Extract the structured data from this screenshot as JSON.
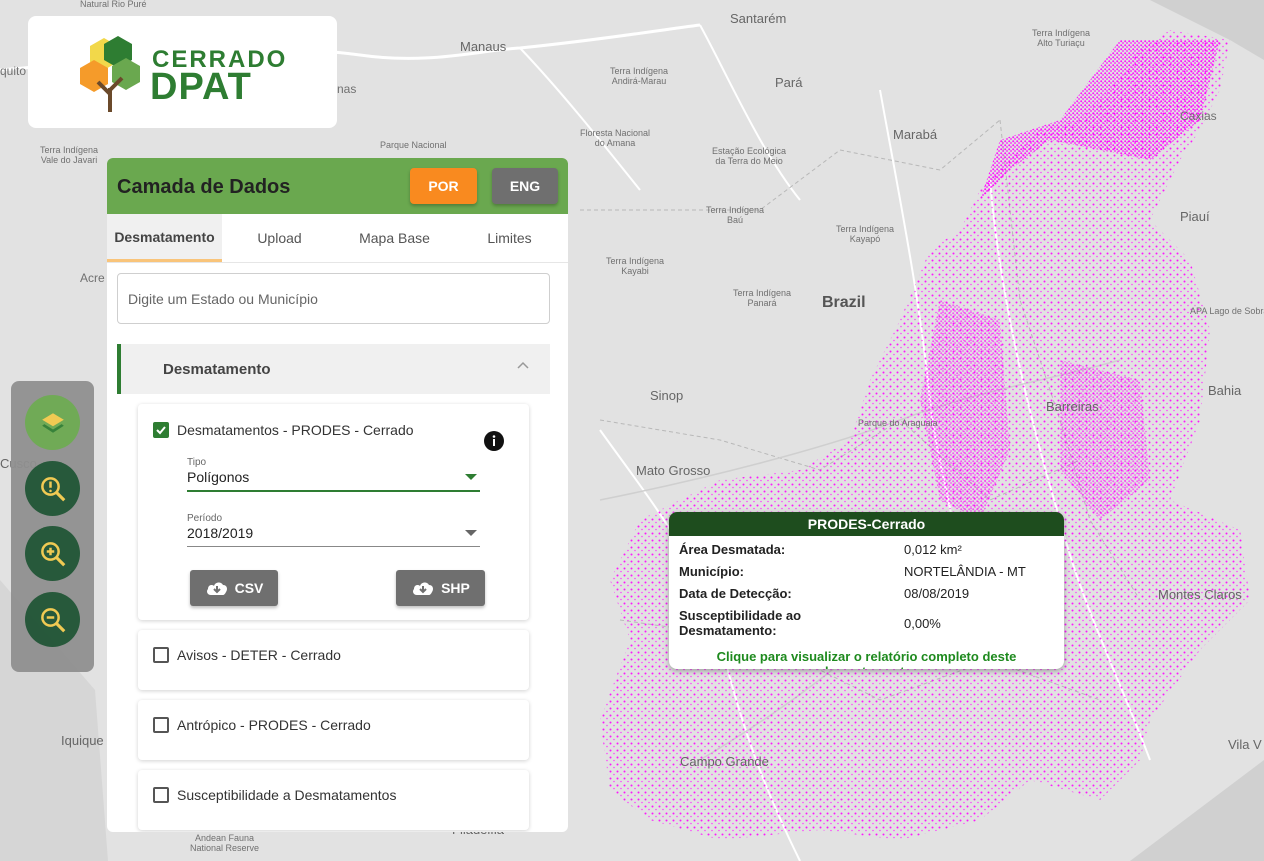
{
  "app": {
    "logo_line1": "CERRADO",
    "logo_line2": "DPAT"
  },
  "map": {
    "labels": {
      "natural_rio_pure": "Natural Rio Puré",
      "santarem": "Santarém",
      "manaus": "Manaus",
      "ti_andira": "Terra Indígena\nAndirá-Marau",
      "para": "Pará",
      "ti_alto_turiacu": "Terra Indígena\nAlto Turiaçu",
      "ti_vale_javari": "Terra Indígena\nVale do Javari",
      "parque_nacional": "Parque Nacional",
      "floresta_amana": "Floresta Nacional\ndo Amana",
      "estacao_ecologica": "Estação Ecológica\nda Terra do Meio",
      "maraba": "Marabá",
      "ti_bau": "Terra Indígena\nBaú",
      "ti_kayapo": "Terra Indígena\nKayapó",
      "ti_kayabi": "Terra Indígena\nKayabi",
      "ti_panara": "Terra Indígena\nPanará",
      "brazil": "Brazil",
      "piaui": "Piauí",
      "apa_sobral": "APA Lago de Sobral",
      "sinop": "Sinop",
      "parque_araguaia": "Parque do Araguaia",
      "barreiras": "Barreiras",
      "bahia": "Bahia",
      "mato_grosso": "Mato Grosso",
      "cusco": "Cusco",
      "montes_claros": "Montes Claros",
      "iquique": "Iquique",
      "campo_grande": "Campo Grande",
      "vila_velha": "Vila V",
      "filadelfia": "Filadélfia",
      "andean_fauna": "Andean Fauna\nNational Reserve",
      "quito": "quito",
      "acre": "Acre",
      "nas": "nas",
      "laias": "Caxias"
    }
  },
  "panel": {
    "title": "Camada de Dados",
    "lang_por": "POR",
    "lang_eng": "ENG",
    "tabs": [
      "Desmatamento",
      "Upload",
      "Mapa Base",
      "Limites"
    ],
    "search_placeholder": "Digite um Estado ou Município",
    "section_title": "Desmatamento",
    "layers": [
      {
        "label": "Desmatamentos - PRODES - Cerrado",
        "checked": true,
        "tipo_caption": "Tipo",
        "tipo_value": "Polígonos",
        "periodo_caption": "Período",
        "periodo_value": "2018/2019",
        "btn_csv": "CSV",
        "btn_shp": "SHP"
      },
      {
        "label": "Avisos - DETER - Cerrado",
        "checked": false
      },
      {
        "label": "Antrópico - PRODES - Cerrado",
        "checked": false
      },
      {
        "label": "Susceptibilidade a Desmatamentos",
        "checked": false
      }
    ]
  },
  "popup": {
    "title": "PRODES-Cerrado",
    "rows": [
      {
        "key": "Área Desmatada:",
        "value": "0,012 km²"
      },
      {
        "key": "Município:",
        "value": "NORTELÂNDIA - MT"
      },
      {
        "key": "Data de Detecção:",
        "value": "08/08/2019"
      },
      {
        "key": "Susceptibilidade ao Desmatamento:",
        "value": "0,00%"
      }
    ],
    "link": "Clique para visualizar o relatório completo deste desmatamento"
  },
  "tools": [
    "layers-icon",
    "alert-search-icon",
    "zoom-in-icon",
    "zoom-out-icon"
  ],
  "colors": {
    "accent_green": "#6aa84f",
    "dark_green": "#1e5233",
    "orange": "#f98a1f",
    "deforestation": "#ff00ff"
  }
}
